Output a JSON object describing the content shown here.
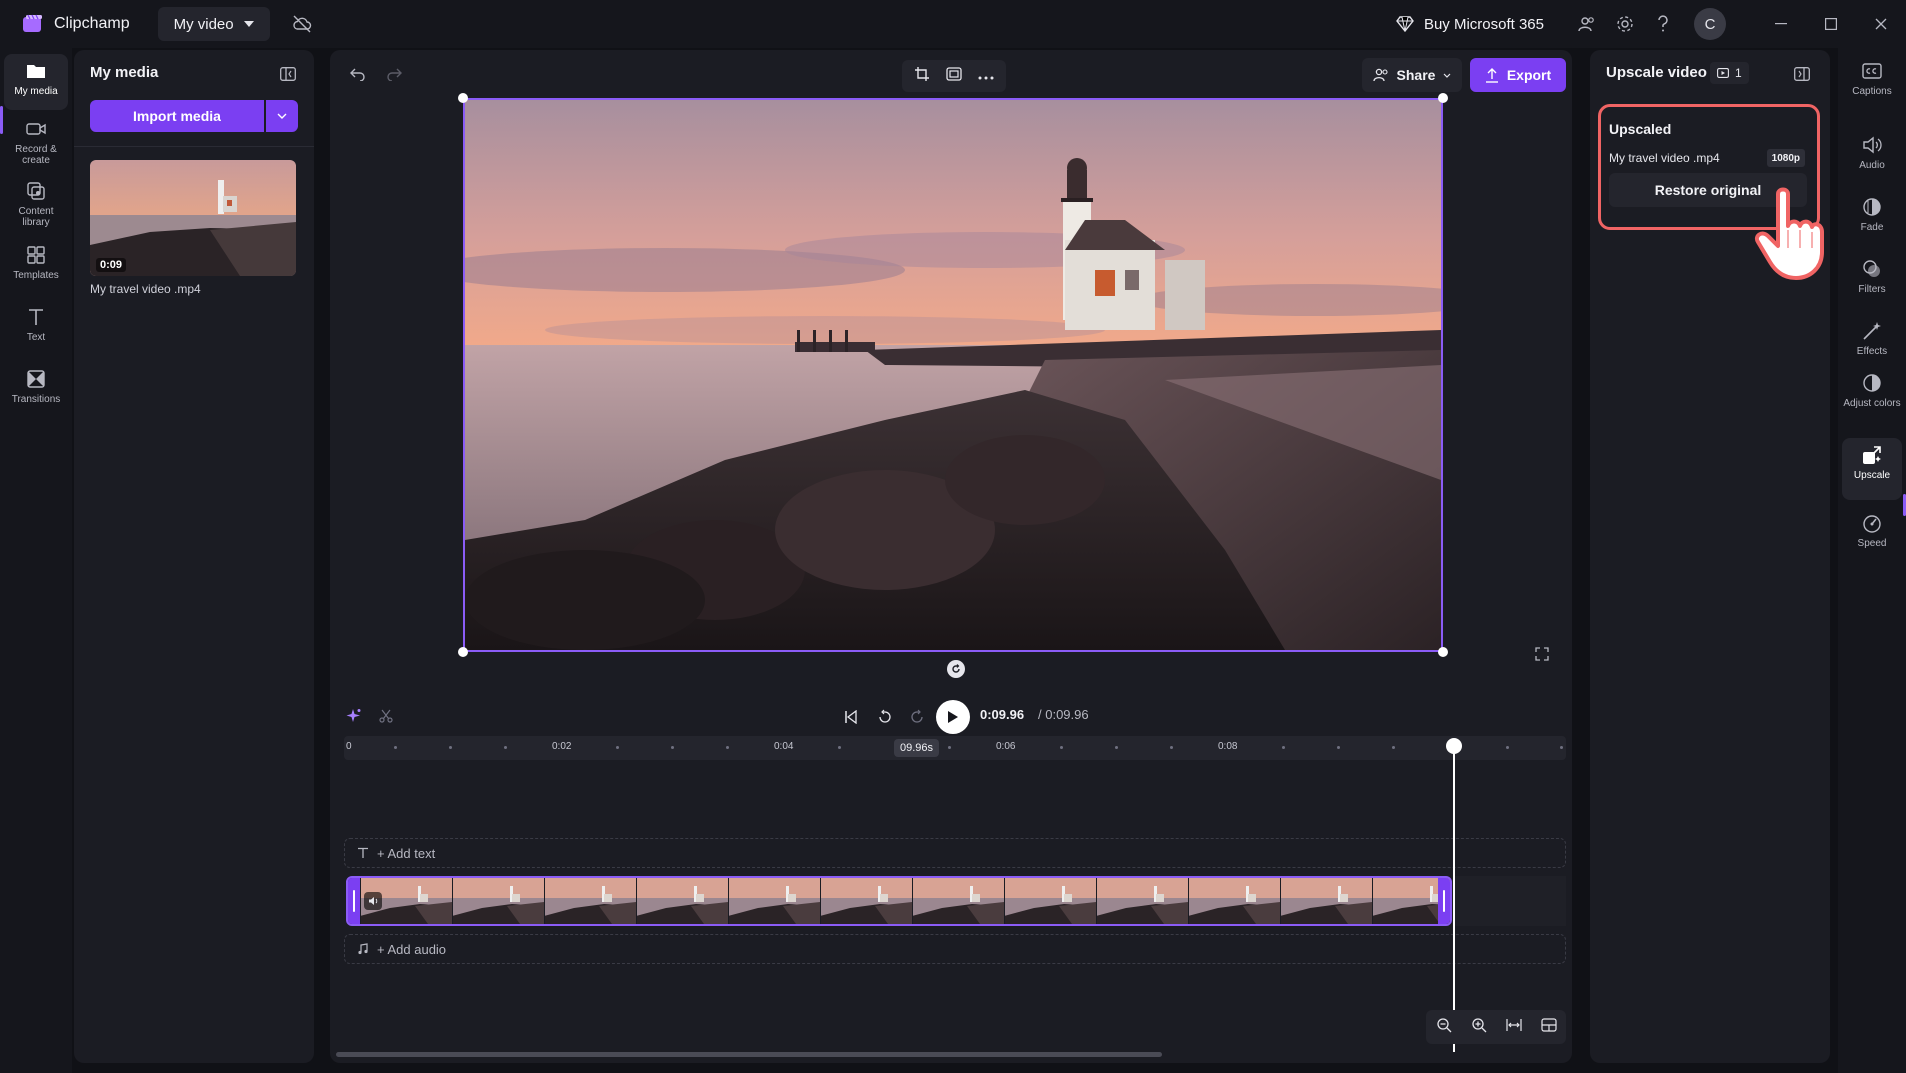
{
  "app": {
    "name": "Clipchamp",
    "project_title": "My video",
    "buy_label": "Buy Microsoft 365",
    "avatar_initial": "C"
  },
  "left_rail": {
    "items": [
      {
        "label": "My media",
        "icon": "folder-icon",
        "active": true
      },
      {
        "label": "Record & create",
        "icon": "camera-icon",
        "active": false
      },
      {
        "label": "Content library",
        "icon": "library-icon",
        "active": false
      },
      {
        "label": "Templates",
        "icon": "templates-icon",
        "active": false
      },
      {
        "label": "Text",
        "icon": "text-icon",
        "active": false
      },
      {
        "label": "Transitions",
        "icon": "transitions-icon",
        "active": false
      }
    ]
  },
  "media_panel": {
    "title": "My media",
    "import_label": "Import media",
    "items": [
      {
        "name": "My travel video .mp4",
        "duration": "0:09"
      }
    ]
  },
  "editor": {
    "share_label": "Share",
    "export_label": "Export",
    "current_time": "0:09.96",
    "total_time": "/ 0:09.96",
    "hover_time": "09.96s",
    "ruler_labels": [
      "0",
      "0:02",
      "0:04",
      "0:06",
      "0:08"
    ],
    "add_text_label": "+ Add text",
    "add_audio_label": "+ Add audio",
    "playhead_fraction": 1.0
  },
  "properties": {
    "title": "Upscale video",
    "badge_count": "1",
    "card_title": "Upscaled",
    "file_name": "My travel video .mp4",
    "resolution": "1080p",
    "restore_label": "Restore original"
  },
  "right_rail": {
    "items": [
      {
        "label": "Captions",
        "icon": "captions-icon",
        "active": false
      },
      {
        "label": "Audio",
        "icon": "speaker-icon",
        "active": false
      },
      {
        "label": "Fade",
        "icon": "fade-icon",
        "active": false
      },
      {
        "label": "Filters",
        "icon": "filters-icon",
        "active": false
      },
      {
        "label": "Effects",
        "icon": "magic-wand-icon",
        "active": false
      },
      {
        "label": "Adjust colors",
        "icon": "contrast-icon",
        "active": false
      },
      {
        "label": "Upscale",
        "icon": "upscale-icon",
        "active": true
      },
      {
        "label": "Speed",
        "icon": "speedometer-icon",
        "active": false
      }
    ]
  },
  "colors": {
    "accent": "#7b3ff2",
    "selection": "#8b5cf6",
    "highlight": "#f06464",
    "background": "#101116",
    "panel": "#1b1c23"
  }
}
